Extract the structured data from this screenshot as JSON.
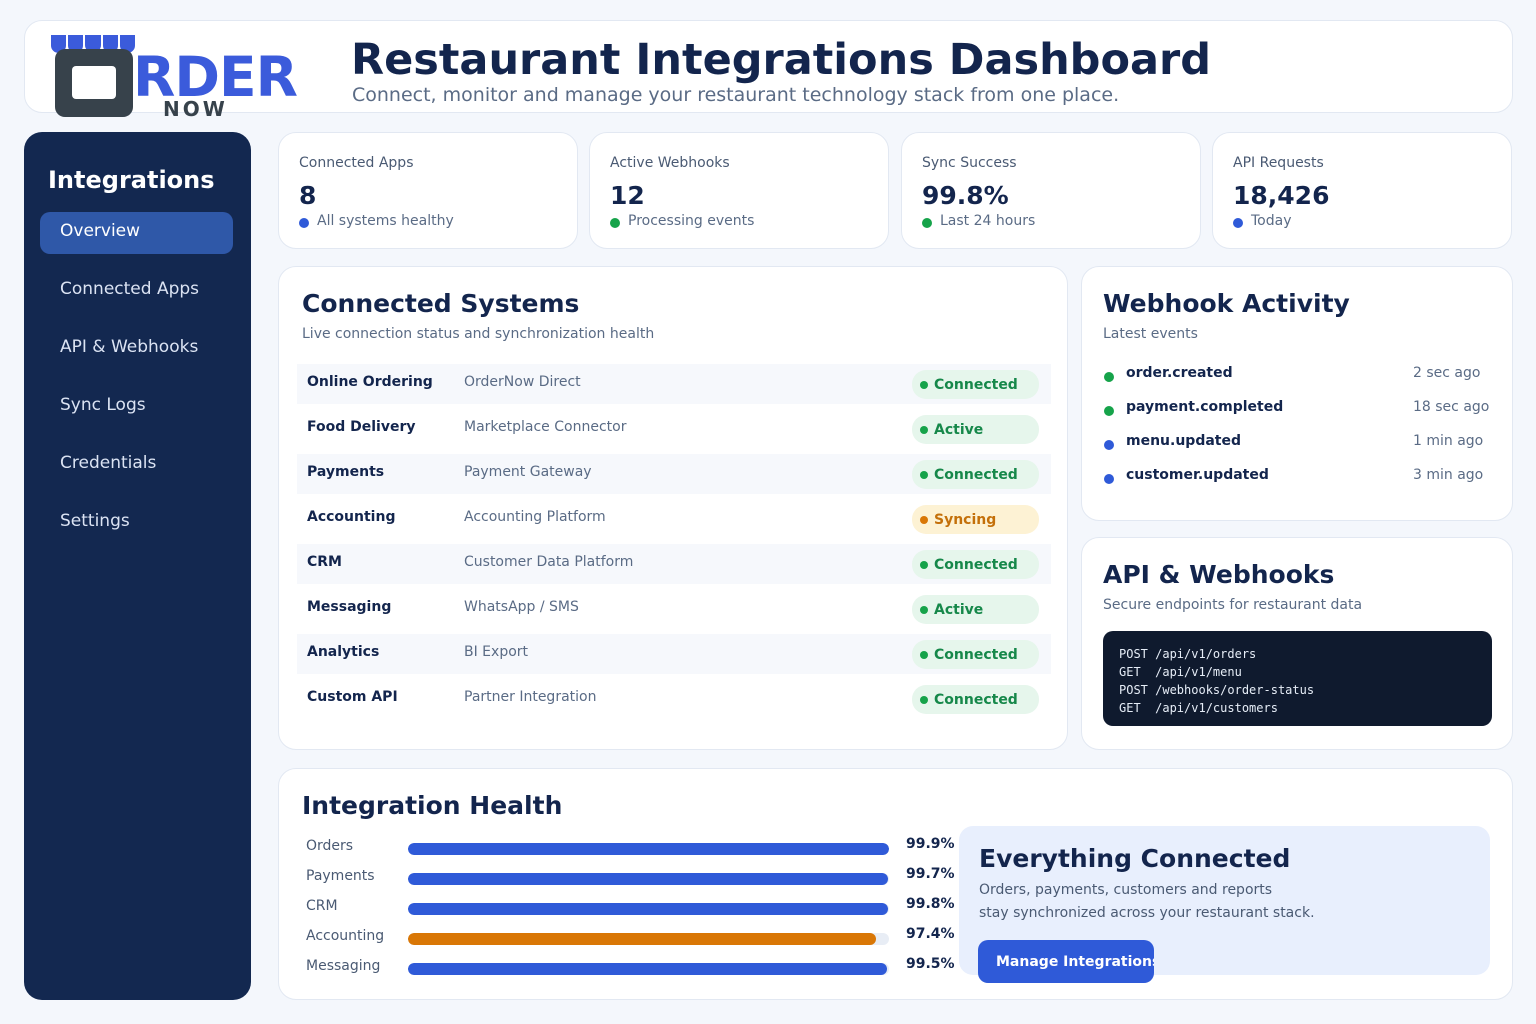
{
  "logo": {
    "main": "RDER",
    "sub": "NOW"
  },
  "header": {
    "title": "Restaurant Integrations Dashboard",
    "subtitle": "Connect, monitor and manage your restaurant technology stack from one place."
  },
  "sidebar": {
    "title": "Integrations",
    "items": [
      {
        "label": "Overview",
        "active": true
      },
      {
        "label": "Connected Apps"
      },
      {
        "label": "API & Webhooks"
      },
      {
        "label": "Sync Logs"
      },
      {
        "label": "Credentials"
      },
      {
        "label": "Settings"
      }
    ]
  },
  "stats": [
    {
      "label": "Connected Apps",
      "value": "8",
      "note": "All systems healthy",
      "dot": "blue"
    },
    {
      "label": "Active Webhooks",
      "value": "12",
      "note": "Processing events",
      "dot": "green"
    },
    {
      "label": "Sync Success",
      "value": "99.8%",
      "note": "Last 24 hours",
      "dot": "green"
    },
    {
      "label": "API Requests",
      "value": "18,426",
      "note": "Today",
      "dot": "blue"
    }
  ],
  "systems": {
    "title": "Connected Systems",
    "subtitle": "Live connection status and synchronization health",
    "rows": [
      {
        "name": "Online Ordering",
        "provider": "OrderNow Direct",
        "status": "Connected",
        "tone": "green"
      },
      {
        "name": "Food Delivery",
        "provider": "Marketplace Connector",
        "status": "Active",
        "tone": "green"
      },
      {
        "name": "Payments",
        "provider": "Payment Gateway",
        "status": "Connected",
        "tone": "green"
      },
      {
        "name": "Accounting",
        "provider": "Accounting Platform",
        "status": "Syncing",
        "tone": "orange"
      },
      {
        "name": "CRM",
        "provider": "Customer Data Platform",
        "status": "Connected",
        "tone": "green"
      },
      {
        "name": "Messaging",
        "provider": "WhatsApp / SMS",
        "status": "Active",
        "tone": "green"
      },
      {
        "name": "Analytics",
        "provider": "BI Export",
        "status": "Connected",
        "tone": "green"
      },
      {
        "name": "Custom API",
        "provider": "Partner Integration",
        "status": "Connected",
        "tone": "green"
      }
    ]
  },
  "webhooks": {
    "title": "Webhook Activity",
    "subtitle": "Latest events",
    "events": [
      {
        "event": "order.created",
        "time": "2 sec ago",
        "dot": "green"
      },
      {
        "event": "payment.completed",
        "time": "18 sec ago",
        "dot": "green"
      },
      {
        "event": "menu.updated",
        "time": "1 min ago",
        "dot": "blue"
      },
      {
        "event": "customer.updated",
        "time": "3 min ago",
        "dot": "blue"
      }
    ]
  },
  "api": {
    "title": "API & Webhooks",
    "subtitle": "Secure endpoints for restaurant data",
    "endpoints": [
      "POST /api/v1/orders",
      "GET  /api/v1/menu",
      "POST /webhooks/order-status",
      "GET  /api/v1/customers"
    ]
  },
  "health": {
    "title": "Integration Health",
    "rows": [
      {
        "label": "Orders",
        "pct": "99.9%",
        "value": 99.9,
        "color": "#2f5ad8"
      },
      {
        "label": "Payments",
        "pct": "99.7%",
        "value": 99.7,
        "color": "#2f5ad8"
      },
      {
        "label": "CRM",
        "pct": "99.8%",
        "value": 99.8,
        "color": "#2f5ad8"
      },
      {
        "label": "Accounting",
        "pct": "97.4%",
        "value": 97.4,
        "color": "#d97706"
      },
      {
        "label": "Messaging",
        "pct": "99.5%",
        "value": 99.5,
        "color": "#2f5ad8"
      }
    ]
  },
  "promo": {
    "title": "Everything Connected",
    "text1": "Orders, payments, customers and reports",
    "text2": "stay synchronized across your restaurant stack.",
    "button": "Manage Integrations"
  }
}
